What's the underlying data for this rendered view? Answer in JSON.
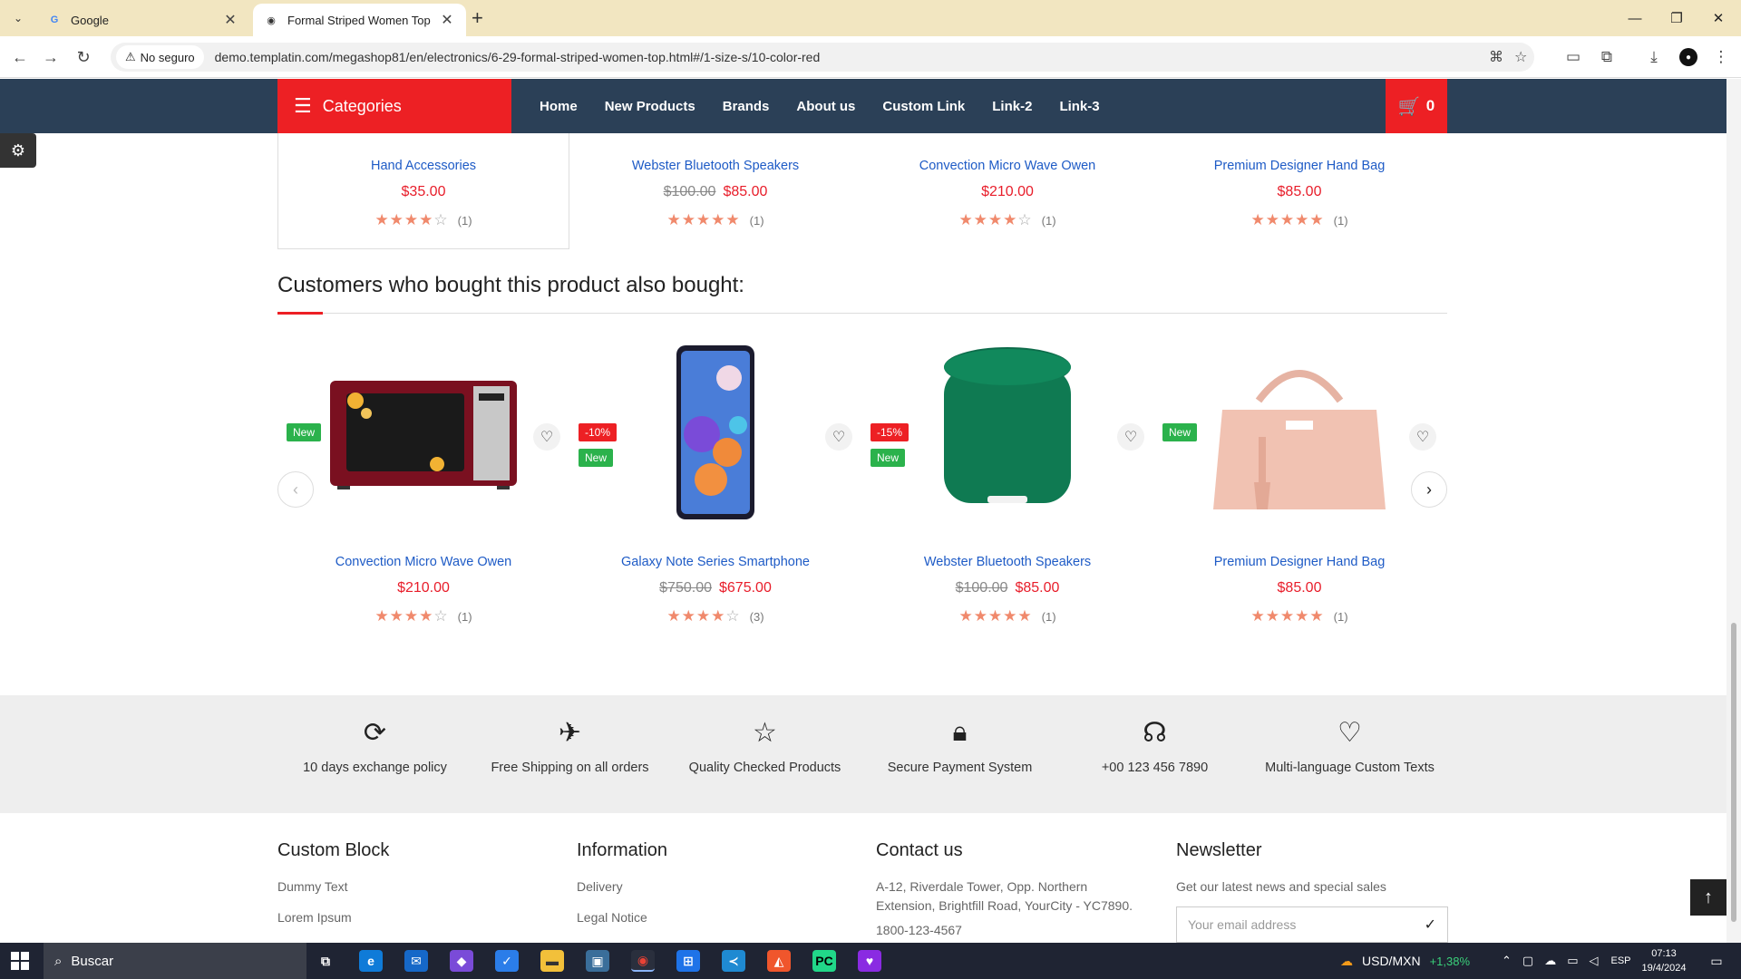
{
  "browser": {
    "tabs": [
      {
        "title": "Google",
        "active": false
      },
      {
        "title": "Formal Striped Women Top",
        "active": true
      }
    ],
    "security_label": "No seguro",
    "url": "demo.templatin.com/megashop81/en/electronics/6-29-formal-striped-women-top.html#/1-size-s/10-color-red"
  },
  "nav": {
    "categories_label": "Categories",
    "menu": [
      "Home",
      "New Products",
      "Brands",
      "About us",
      "Custom Link",
      "Link-2",
      "Link-3"
    ],
    "cart_count": "0"
  },
  "top_products": [
    {
      "name": "Hand Accessories",
      "old_price": "",
      "price": "$35.00",
      "rating": 4,
      "reviews": "(1)"
    },
    {
      "name": "Webster Bluetooth Speakers",
      "old_price": "$100.00",
      "price": "$85.00",
      "rating": 5,
      "reviews": "(1)"
    },
    {
      "name": "Convection Micro Wave Owen",
      "old_price": "",
      "price": "$210.00",
      "rating": 4,
      "reviews": "(1)"
    },
    {
      "name": "Premium Designer Hand Bag",
      "old_price": "",
      "price": "$85.00",
      "rating": 5,
      "reviews": "(1)"
    }
  ],
  "also_bought": {
    "title": "Customers who bought this product also bought:",
    "products": [
      {
        "name": "Convection Micro Wave Owen",
        "old_price": "",
        "price": "$210.00",
        "rating": 4,
        "reviews": "(1)",
        "badges": [
          "New"
        ]
      },
      {
        "name": "Galaxy Note Series Smartphone",
        "old_price": "$750.00",
        "price": "$675.00",
        "rating": 4,
        "reviews": "(3)",
        "badges": [
          "-10%",
          "New"
        ]
      },
      {
        "name": "Webster Bluetooth Speakers",
        "old_price": "$100.00",
        "price": "$85.00",
        "rating": 5,
        "reviews": "(1)",
        "badges": [
          "-15%",
          "New"
        ]
      },
      {
        "name": "Premium Designer Hand Bag",
        "old_price": "",
        "price": "$85.00",
        "rating": 5,
        "reviews": "(1)",
        "badges": [
          "New"
        ]
      }
    ]
  },
  "features": [
    {
      "icon": "exchange-icon",
      "text": "10 days exchange policy"
    },
    {
      "icon": "airplane-icon",
      "text": "Free Shipping on all orders"
    },
    {
      "icon": "star-icon",
      "text": "Quality Checked Products"
    },
    {
      "icon": "lock-icon",
      "text": "Secure Payment System"
    },
    {
      "icon": "headset-icon",
      "text": "+00 123 456 7890"
    },
    {
      "icon": "heart-icon",
      "text": "Multi-language Custom Texts"
    }
  ],
  "footer": {
    "custom_block": {
      "title": "Custom Block",
      "links": [
        "Dummy Text",
        "Lorem Ipsum"
      ]
    },
    "information": {
      "title": "Information",
      "links": [
        "Delivery",
        "Legal Notice"
      ]
    },
    "contact": {
      "title": "Contact us",
      "address": "A-12, Riverdale Tower, Opp. Northern Extension, Brightfill Road, YourCity - YC7890.",
      "phone": "1800-123-4567"
    },
    "newsletter": {
      "title": "Newsletter",
      "text": "Get our latest news and special sales",
      "placeholder": "Your email address"
    }
  },
  "taskbar": {
    "search_label": "Buscar",
    "ticker": "USD/MXN",
    "ticker_change": "+1,38%",
    "lang": "ESP",
    "time": "07:13",
    "date": "19/4/2024"
  },
  "colors": {
    "accent": "#ed2024",
    "nav": "#2b4057",
    "link": "#1e5bc6",
    "price": "#e81d2a",
    "badge_new": "#2bb24c"
  }
}
